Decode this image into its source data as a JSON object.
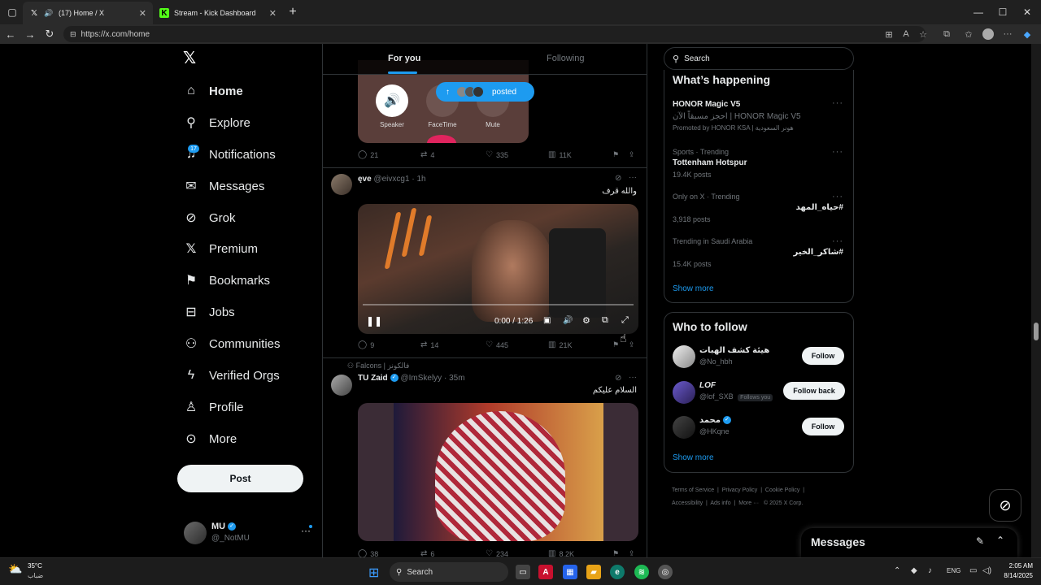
{
  "browser": {
    "tabs": [
      {
        "title": "(17) Home / X",
        "favicon": "x-logo-icon"
      },
      {
        "title": "Stream - Kick Dashboard",
        "favicon": "kick-logo-icon"
      }
    ],
    "url": "https://x.com/home"
  },
  "nav": {
    "items": [
      {
        "label": "Home",
        "icon": "home-icon"
      },
      {
        "label": "Explore",
        "icon": "search-icon"
      },
      {
        "label": "Notifications",
        "icon": "bell-icon",
        "badge": "17"
      },
      {
        "label": "Messages",
        "icon": "mail-icon"
      },
      {
        "label": "Grok",
        "icon": "grok-icon"
      },
      {
        "label": "Premium",
        "icon": "x-logo-icon"
      },
      {
        "label": "Bookmarks",
        "icon": "bookmark-icon"
      },
      {
        "label": "Jobs",
        "icon": "briefcase-icon"
      },
      {
        "label": "Communities",
        "icon": "people-icon"
      },
      {
        "label": "Verified Orgs",
        "icon": "lightning-icon"
      },
      {
        "label": "Profile",
        "icon": "person-icon"
      },
      {
        "label": "More",
        "icon": "more-circle-icon"
      }
    ],
    "post_label": "Post",
    "account": {
      "name": "MU",
      "handle": "@_NotMU"
    }
  },
  "feed": {
    "tabs": [
      "For you",
      "Following"
    ],
    "posts": [
      {
        "media_labels": [
          "Speaker",
          "FaceTime",
          "Mute"
        ],
        "posted_pill": "posted",
        "replies": "21",
        "reposts": "4",
        "likes": "335",
        "views": "11K"
      },
      {
        "name": "ęve",
        "handle": "@eivxcg1",
        "time": "1h",
        "text": "والله قرف",
        "video_time": "0:00 / 1:26",
        "replies": "9",
        "reposts": "14",
        "likes": "445",
        "views": "21K"
      },
      {
        "social_context": "Falcons | فالكونز",
        "name": "TU Zaid",
        "handle": "@ImSkelyy",
        "time": "35m",
        "text": "السلام عليكم",
        "replies": "38",
        "reposts": "6",
        "likes": "234",
        "views": "8.2K"
      }
    ]
  },
  "right": {
    "search_placeholder": "Search",
    "happening": {
      "title": "What’s happening",
      "items": [
        {
          "name": "HONOR Magic V5",
          "sub": "احجز مسبقاً الآن | HONOR Magic V5",
          "meta": "Promoted by HONOR KSA | هونر السعودية"
        },
        {
          "meta": "Sports · Trending",
          "name": "Tottenham Hotspur",
          "posts": "19.4K posts"
        },
        {
          "meta": "Only on X · Trending",
          "name": "#حياه_المهد",
          "posts": "3,918 posts"
        },
        {
          "meta": "Trending in Saudi Arabia",
          "name": "#شاكر_الخير",
          "posts": "15.4K posts"
        }
      ],
      "show_more": "Show more"
    },
    "who_to_follow": {
      "title": "Who to follow",
      "items": [
        {
          "name": "هيئة كشف الهبات",
          "handle": "@No_hbh",
          "button": "Follow"
        },
        {
          "name": "LOF",
          "handle": "@lof_SXB",
          "tag": "Follows you",
          "button": "Follow back"
        },
        {
          "name": "محمد",
          "handle": "@HKqne",
          "button": "Follow"
        }
      ],
      "show_more": "Show more"
    },
    "footer": {
      "links": [
        "Terms of Service",
        "Privacy Policy",
        "Cookie Policy",
        "Accessibility",
        "Ads info",
        "More ···"
      ],
      "copyright": "© 2025 X Corp."
    },
    "messages_label": "Messages"
  },
  "taskbar": {
    "weather_temp": "35°C",
    "weather_desc": "ضباب",
    "search_label": "Search",
    "lang": "ENG",
    "time": "2:05 AM",
    "date": "8/14/2025"
  },
  "colors": {
    "accent": "#1d9bf0",
    "background": "#000000",
    "border": "#2f3336",
    "muted": "#71767b"
  }
}
